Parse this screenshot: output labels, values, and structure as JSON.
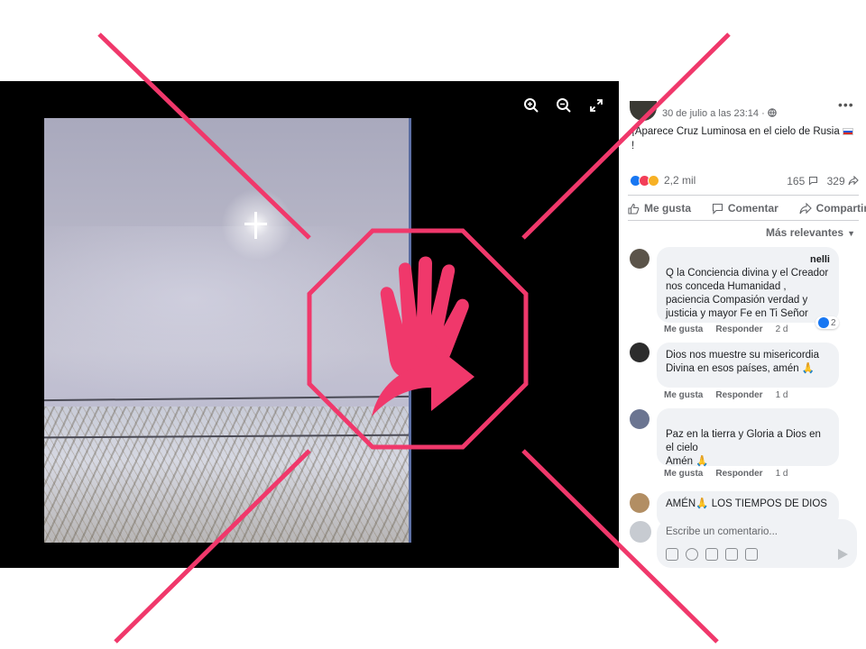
{
  "post": {
    "date": "30 de julio a las 23:14 · ",
    "title": "¡Aparece Cruz Luminosa en el cielo de Rusia ",
    "title_tail": "!",
    "reactions_count": "2,2 mil",
    "comments_count": "165",
    "shares_count": "329"
  },
  "actions": {
    "like": "Me gusta",
    "comment": "Comentar",
    "share": "Compartir"
  },
  "sort": {
    "label": "Más relevantes"
  },
  "comments": [
    {
      "author": "nelli",
      "text": "Q la Conciencia divina y el Creador nos conceda Humanidad , paciencia Compasión verdad y justicia y mayor Fe en Ti Señor",
      "like": "Me gusta",
      "reply": "Responder",
      "time": "2 d",
      "likes": "2"
    },
    {
      "text": "Dios nos muestre su misericordia Divina en esos países, amén 🙏",
      "like": "Me gusta",
      "reply": "Responder",
      "time": "1 d"
    },
    {
      "text": "Paz en la tierra y Gloria a Dios en el cielo\nAmén 🙏",
      "like": "Me gusta",
      "reply": "Responder",
      "time": "1 d"
    },
    {
      "text": "AMÉN🙏 LOS TIEMPOS DE DIOS"
    }
  ],
  "composer": {
    "placeholder": "Escribe un comentario..."
  },
  "colors": {
    "warning_pink": "#f0386b",
    "facebook_blue": "#1877f2"
  }
}
